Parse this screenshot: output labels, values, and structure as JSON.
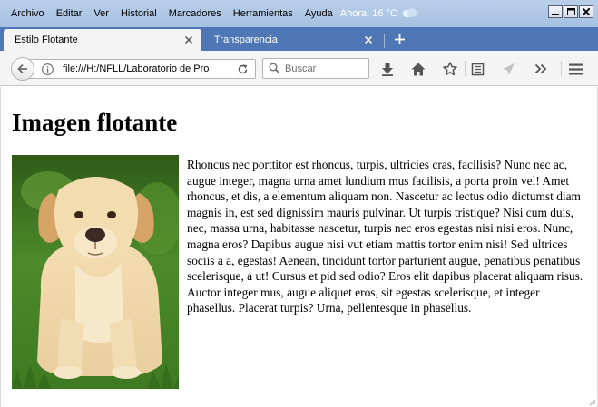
{
  "menubar": {
    "items": [
      "Archivo",
      "Editar",
      "Ver",
      "Historial",
      "Marcadores",
      "Herramientas",
      "Ayuda"
    ],
    "weather_text": "Ahora: 16 °C",
    "weather_icon": "cloud-icon"
  },
  "tabs": [
    {
      "label": "Estilo Flotante",
      "active": true
    },
    {
      "label": "Transparencia",
      "active": false
    }
  ],
  "toolbar": {
    "url": "file:///H:/NFLL/Laboratorio de Pro",
    "search_placeholder": "Buscar"
  },
  "page": {
    "title": "Imagen flotante",
    "image_icon": "dog-photo",
    "paragraph": "Rhoncus nec porttitor est rhoncus, turpis, ultricies cras, facilisis? Nunc nec ac, augue integer, magna urna amet lundium mus facilisis, a porta proin vel! Amet rhoncus, et dis, a elementum aliquam non. Nascetur ac lectus odio dictumst diam magnis in, est sed dignissim mauris pulvinar. Ut turpis tristique? Nisi cum duis, nec, massa urna, habitasse nascetur, turpis nec eros egestas nisi nisi eros. Nunc, magna eros? Dapibus augue nisi vut etiam mattis tortor enim nisi! Sed ultrices sociis a a, egestas! Aenean, tincidunt tortor parturient augue, penatibus penatibus scelerisque, a ut! Cursus et pid sed odio? Eros elit dapibus placerat aliquam risus. Auctor integer mus, augue aliquet eros, sit egestas scelerisque, et integer phasellus. Placerat turpis? Urna, pellentesque in phasellus."
  },
  "colors": {
    "menubar": "#b9cfe9",
    "tabstrip": "#4f77b6",
    "toolbar": "#f4f4f4"
  }
}
